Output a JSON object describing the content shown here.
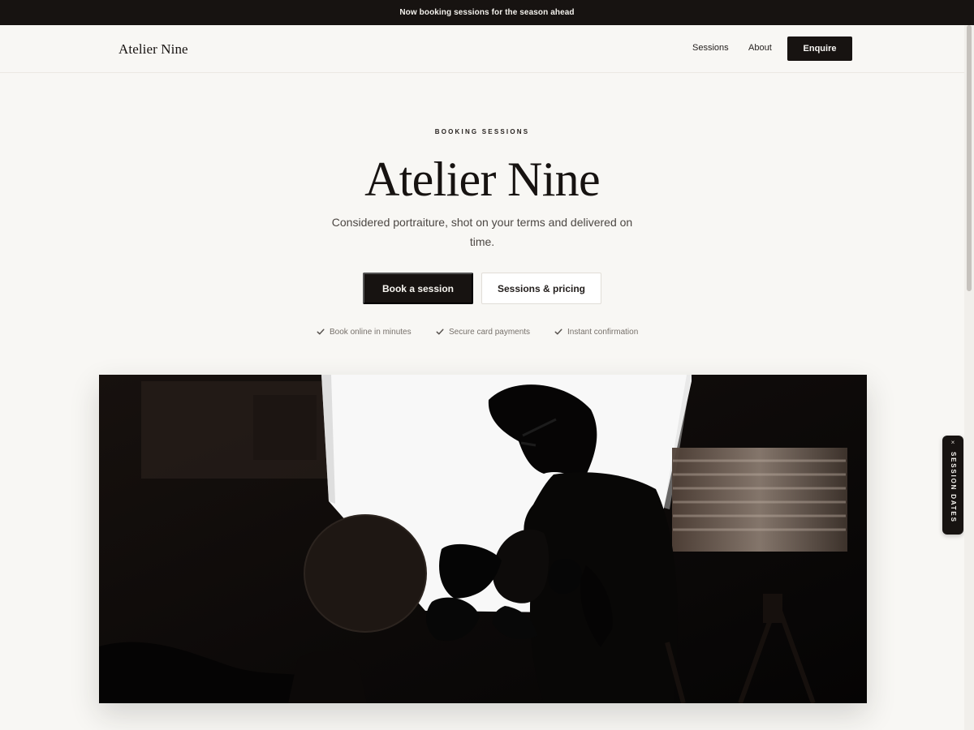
{
  "announcement": {
    "text": "Now booking sessions for the season ahead"
  },
  "header": {
    "logo": "Atelier Nine",
    "nav": {
      "sessions": "Sessions",
      "about": "About",
      "enquire": "Enquire"
    }
  },
  "hero": {
    "eyebrow": "BOOKING SESSIONS",
    "title": "Atelier Nine",
    "subtitle": "Considered portraiture, shot on your terms and delivered on time.",
    "buttons": {
      "primary": "Book a session",
      "secondary": "Sessions & pricing"
    },
    "trust_items": [
      "Book online in minutes",
      "Secure card payments",
      "Instant confirmation"
    ]
  },
  "side_tab": {
    "close": "×",
    "label": "SESSION DATES"
  },
  "colors": {
    "ink": "#171311",
    "cream": "#f8f7f4",
    "muted": "#77716b"
  },
  "icons": {
    "check": "check-icon",
    "close": "close-icon"
  }
}
